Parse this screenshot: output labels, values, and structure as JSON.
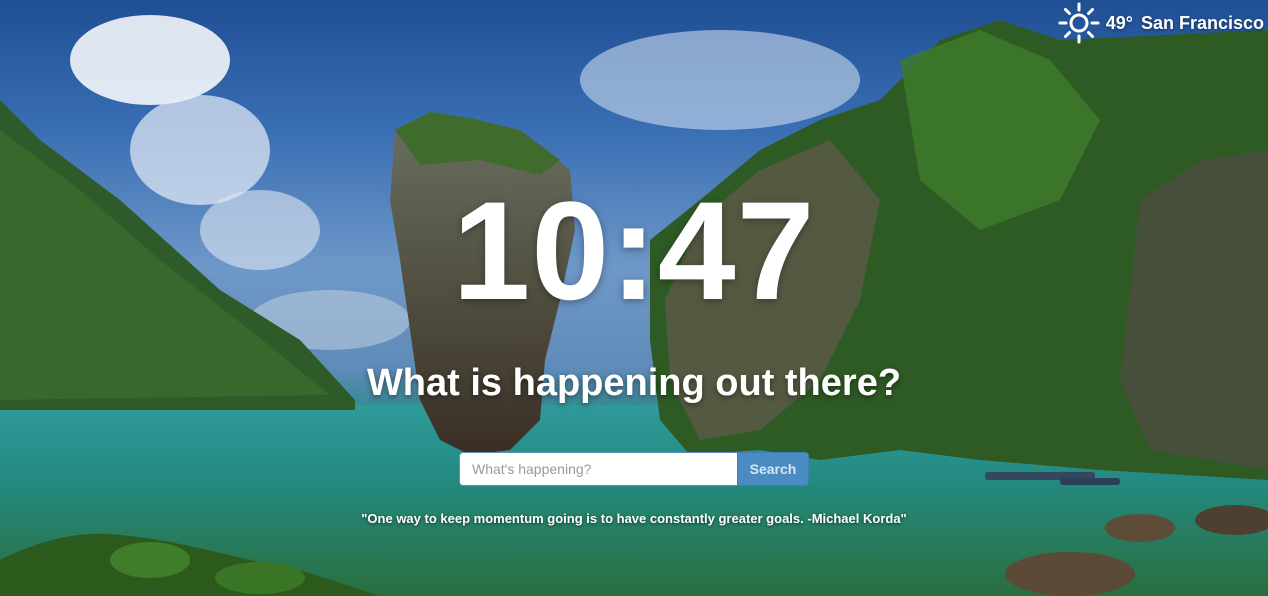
{
  "weather": {
    "icon": "sun-icon",
    "temperature": "49°",
    "city": "San Francisco"
  },
  "clock": {
    "time": "10:47"
  },
  "headline": "What is happening out there?",
  "search": {
    "placeholder": "What's happening?",
    "value": "",
    "button_label": "Search"
  },
  "quote": "\"One way to keep momentum going is to have constantly greater goals. -Michael Korda\"",
  "colors": {
    "search_button": "#4a8cc2",
    "text": "#ffffff"
  }
}
